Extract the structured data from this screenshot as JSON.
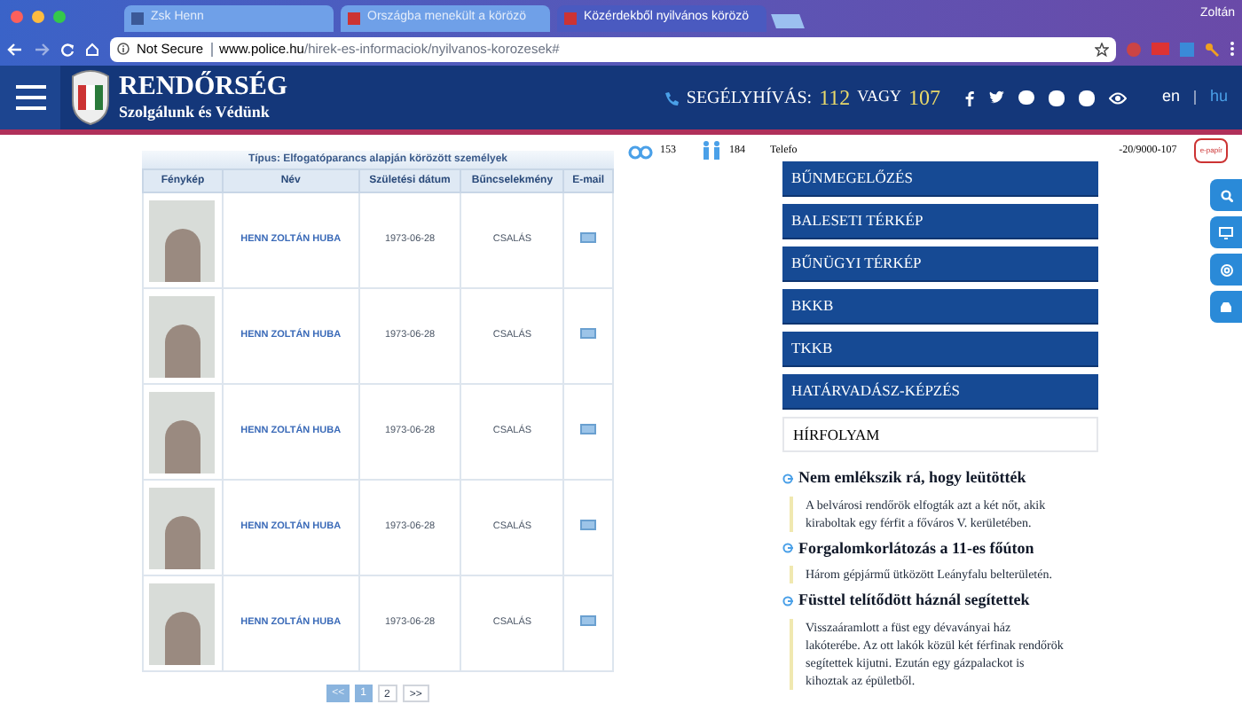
{
  "browser": {
    "tabs": [
      {
        "label": "Zsk Henn",
        "selected": false
      },
      {
        "label": "Országba menekült a körözö",
        "selected": false
      },
      {
        "label": "Közérdekből nyilvános körözö",
        "selected": true
      }
    ],
    "profile": "Zoltán",
    "security": "Not Secure",
    "url_domain": "www.police.hu",
    "url_path": "/hirek-es-informaciok/nyilvanos-korozesek#"
  },
  "header": {
    "logo_title": "RENDŐRSÉG",
    "logo_subtitle": "Szolgálunk és Védünk",
    "hotline_label": "SEGÉLYHÍVÁS:",
    "hotline_1": "112",
    "hotline_or": "VAGY",
    "hotline_2": "107",
    "languages": [
      {
        "label": "en",
        "selected": false
      },
      {
        "label": "hu",
        "selected": true
      }
    ]
  },
  "stats": [
    {
      "value": "153"
    },
    {
      "value": "184"
    }
  ],
  "phone_text_start": "Telefo",
  "phone_text_end": "-20/9000-107",
  "epapir": "e-papír",
  "table": {
    "caption": "Típus: Elfogatóparancs alapján körözött személyek",
    "columns": [
      "Fénykép",
      "Név",
      "Születési dátum",
      "Bűncselekmény",
      "E-mail"
    ],
    "rows": [
      {
        "name": "HENN ZOLTÁN HUBA",
        "birth": "1973-06-28",
        "crime": "CSALÁS"
      },
      {
        "name": "HENN ZOLTÁN HUBA",
        "birth": "1973-06-28",
        "crime": "CSALÁS"
      },
      {
        "name": "HENN ZOLTÁN HUBA",
        "birth": "1973-06-28",
        "crime": "CSALÁS"
      },
      {
        "name": "HENN ZOLTÁN HUBA",
        "birth": "1973-06-28",
        "crime": "CSALÁS"
      },
      {
        "name": "HENN ZOLTÁN HUBA",
        "birth": "1973-06-28",
        "crime": "CSALÁS"
      }
    ]
  },
  "pagination": [
    {
      "label": "<<",
      "kind": "nav",
      "disabled": true
    },
    {
      "label": "1",
      "kind": "page",
      "selected": true
    },
    {
      "label": "2",
      "kind": "page",
      "selected": false
    },
    {
      "label": ">>",
      "kind": "nav",
      "disabled": false
    }
  ],
  "menu": [
    "BŰNMEGELŐZÉS",
    "BALESETI TÉRKÉP",
    "BŰNÜGYI TÉRKÉP",
    "BKKB",
    "TKKB",
    "HATÁRVADÁSZ-KÉPZÉS"
  ],
  "news_heading": "HÍRFOLYAM",
  "news": [
    {
      "title": "Nem emlékszik rá, hogy leütötték",
      "text": "A belvárosi rendőrök elfogták azt a két nőt, akik kiraboltak egy férfit a főváros V. kerületében."
    },
    {
      "title": "Forgalomkorlátozás a 11-es főúton",
      "text": "Három gépjármű ütközött Leányfalu belterületén."
    },
    {
      "title": "Füsttel telítődött háznál segítettek",
      "text": "Visszaáramlott a füst egy dévaványai ház lakóterébe. Az ott lakók közül két férfinak rendőrök segítettek kijutni. Ezután egy gázpalackot is kihoztak az épületből."
    }
  ]
}
